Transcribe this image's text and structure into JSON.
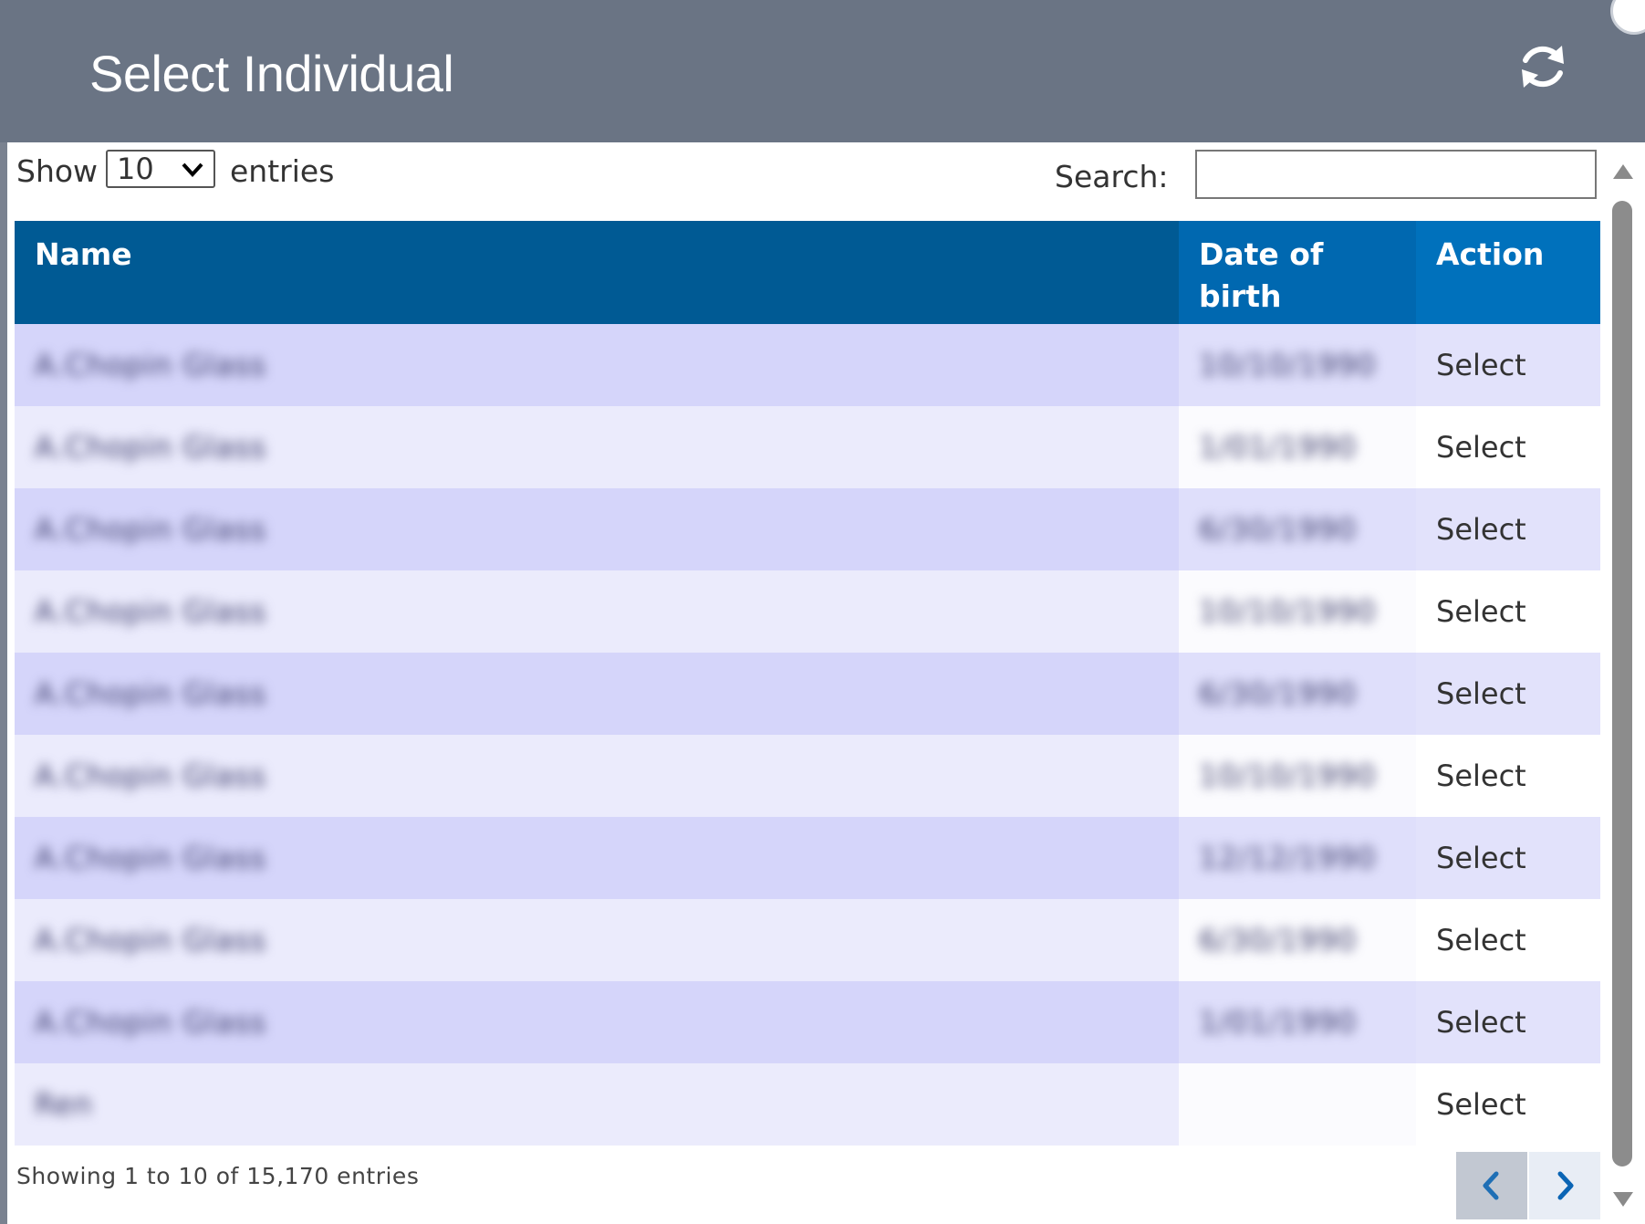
{
  "dialog": {
    "title": "Select Individual"
  },
  "controls": {
    "show_label": "Show",
    "length_value": "10",
    "entries_label": "entries",
    "search_label": "Search:",
    "search_value": ""
  },
  "table": {
    "columns": [
      "Name",
      "Date of birth",
      "Action"
    ],
    "rows": [
      {
        "name": "A.Chopin Glass",
        "dob": "10/10/1990",
        "action": "Select"
      },
      {
        "name": "A.Chopin Glass",
        "dob": "1/01/1990",
        "action": "Select"
      },
      {
        "name": "A.Chopin Glass",
        "dob": "6/30/1990",
        "action": "Select"
      },
      {
        "name": "A.Chopin Glass",
        "dob": "10/10/1990",
        "action": "Select"
      },
      {
        "name": "A.Chopin Glass",
        "dob": "6/30/1990",
        "action": "Select"
      },
      {
        "name": "A.Chopin Glass",
        "dob": "10/10/1990",
        "action": "Select"
      },
      {
        "name": "A.Chopin Glass",
        "dob": "12/12/1990",
        "action": "Select"
      },
      {
        "name": "A.Chopin Glass",
        "dob": "6/30/1990",
        "action": "Select"
      },
      {
        "name": "A.Chopin Glass",
        "dob": "1/01/1990",
        "action": "Select"
      },
      {
        "name": "Ren",
        "dob": "",
        "action": "Select"
      }
    ]
  },
  "footer": {
    "info": "Showing 1 to 10 of 15,170 entries"
  },
  "icons": {
    "refresh": "refresh-icon",
    "prev": "chevron-left-icon",
    "next": "chevron-right-icon",
    "dropdown": "chevron-down-icon"
  },
  "colors": {
    "header_bg": "#6a7484",
    "table_header": "#0071bc",
    "row_odd": "#d5d5fa",
    "row_even": "#ebebfc"
  }
}
